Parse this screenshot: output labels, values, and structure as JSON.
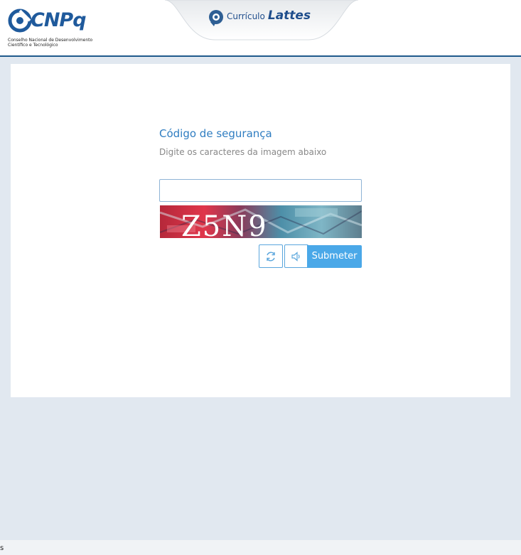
{
  "header": {
    "brand_name": "CNPq",
    "brand_subtitle_line1": "Conselho Nacional de Desenvolvimento",
    "brand_subtitle_line2": "Científico e Tecnológico",
    "product_label_prefix": "Currículo",
    "product_label_name": "Lattes"
  },
  "security": {
    "title": "Código de segurança",
    "hint": "Digite os caracteres da imagem abaixo",
    "input_value": "",
    "captcha_text": "Z5N9",
    "refresh_icon": "refresh-icon",
    "audio_icon": "speaker-icon",
    "submit_label": "Submeter"
  },
  "colors": {
    "accent": "#2f7dc1",
    "button": "#4aa8e8",
    "page_background": "#e1e8f0",
    "header_border": "#1f5a8c"
  },
  "footer": {
    "text": "s"
  }
}
